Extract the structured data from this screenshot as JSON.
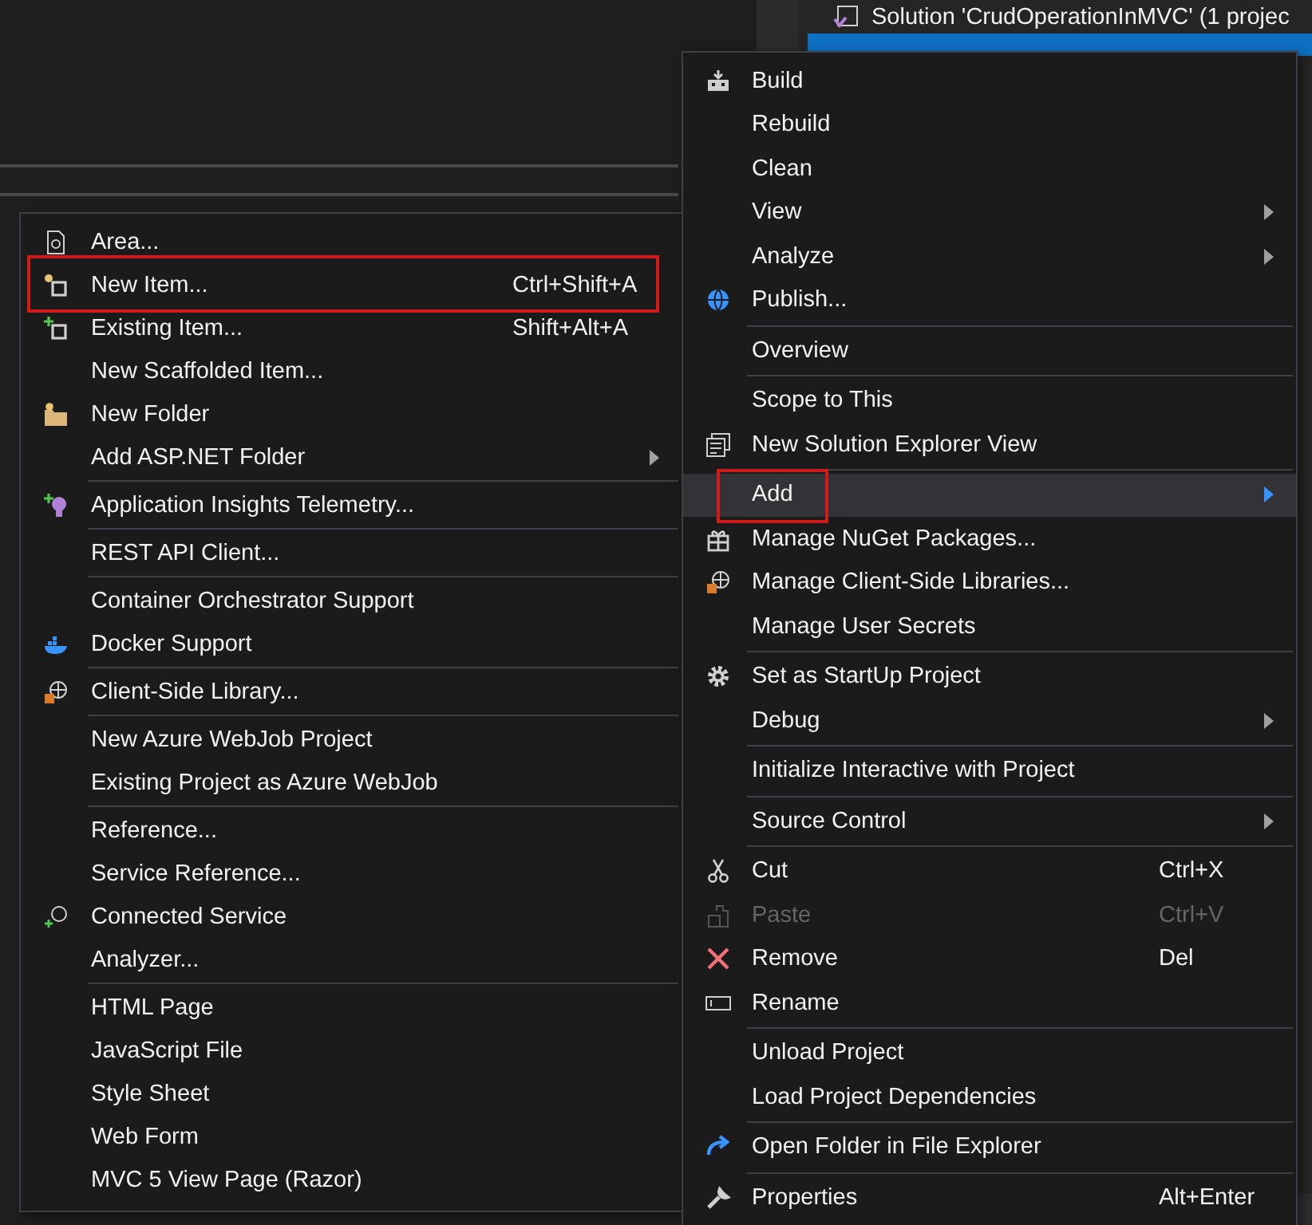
{
  "solution_explorer": {
    "solution_row": "Solution 'CrudOperationInMVC' (1 projec",
    "project_row_selected": true
  },
  "context_menu": {
    "items": [
      {
        "kind": "item",
        "label": "Build",
        "submenu": false,
        "selected": false,
        "disabled": false,
        "outlined": false
      },
      {
        "kind": "item",
        "label": "Rebuild",
        "submenu": false,
        "selected": false,
        "disabled": false,
        "outlined": false
      },
      {
        "kind": "item",
        "label": "Clean",
        "submenu": false,
        "selected": false,
        "disabled": false,
        "outlined": false
      },
      {
        "kind": "item",
        "label": "View",
        "submenu": true,
        "selected": false,
        "disabled": false,
        "outlined": false
      },
      {
        "kind": "item",
        "label": "Analyze",
        "submenu": true,
        "selected": false,
        "disabled": false,
        "outlined": false
      },
      {
        "kind": "item",
        "label": "Publish...",
        "submenu": false,
        "selected": false,
        "disabled": false,
        "outlined": false
      },
      {
        "kind": "separator"
      },
      {
        "kind": "item",
        "label": "Overview",
        "submenu": false,
        "selected": false,
        "disabled": false,
        "outlined": false
      },
      {
        "kind": "separator"
      },
      {
        "kind": "item",
        "label": "Scope to This",
        "submenu": false,
        "selected": false,
        "disabled": false,
        "outlined": false
      },
      {
        "kind": "item",
        "label": "New Solution Explorer View",
        "submenu": false,
        "selected": false,
        "disabled": false,
        "outlined": false
      },
      {
        "kind": "separator"
      },
      {
        "kind": "item",
        "label": "Add",
        "submenu": true,
        "selected": true,
        "disabled": false,
        "outlined": true
      },
      {
        "kind": "item",
        "label": "Manage NuGet Packages...",
        "submenu": false,
        "selected": false,
        "disabled": false,
        "outlined": false
      },
      {
        "kind": "item",
        "label": "Manage Client-Side Libraries...",
        "submenu": false,
        "selected": false,
        "disabled": false,
        "outlined": false
      },
      {
        "kind": "item",
        "label": "Manage User Secrets",
        "submenu": false,
        "selected": false,
        "disabled": false,
        "outlined": false
      },
      {
        "kind": "separator"
      },
      {
        "kind": "item",
        "label": "Set as StartUp Project",
        "submenu": false,
        "selected": false,
        "disabled": false,
        "outlined": false
      },
      {
        "kind": "item",
        "label": "Debug",
        "submenu": true,
        "selected": false,
        "disabled": false,
        "outlined": false
      },
      {
        "kind": "separator"
      },
      {
        "kind": "item",
        "label": "Initialize Interactive with Project",
        "submenu": false,
        "selected": false,
        "disabled": false,
        "outlined": false
      },
      {
        "kind": "separator"
      },
      {
        "kind": "item",
        "label": "Source Control",
        "submenu": true,
        "selected": false,
        "disabled": false,
        "outlined": false
      },
      {
        "kind": "separator"
      },
      {
        "kind": "item",
        "label": "Cut",
        "shortcut": "Ctrl+X",
        "submenu": false,
        "selected": false,
        "disabled": false,
        "outlined": false
      },
      {
        "kind": "item",
        "label": "Paste",
        "shortcut": "Ctrl+V",
        "submenu": false,
        "selected": false,
        "disabled": true,
        "outlined": false
      },
      {
        "kind": "item",
        "label": "Remove",
        "shortcut": "Del",
        "submenu": false,
        "selected": false,
        "disabled": false,
        "outlined": false
      },
      {
        "kind": "item",
        "label": "Rename",
        "submenu": false,
        "selected": false,
        "disabled": false,
        "outlined": false
      },
      {
        "kind": "separator"
      },
      {
        "kind": "item",
        "label": "Unload Project",
        "submenu": false,
        "selected": false,
        "disabled": false,
        "outlined": false
      },
      {
        "kind": "item",
        "label": "Load Project Dependencies",
        "submenu": false,
        "selected": false,
        "disabled": false,
        "outlined": false
      },
      {
        "kind": "separator"
      },
      {
        "kind": "item",
        "label": "Open Folder in File Explorer",
        "submenu": false,
        "selected": false,
        "disabled": false,
        "outlined": false
      },
      {
        "kind": "separator"
      },
      {
        "kind": "item",
        "label": "Properties",
        "shortcut": "Alt+Enter",
        "submenu": false,
        "selected": false,
        "disabled": false,
        "outlined": false
      }
    ]
  },
  "add_submenu": {
    "items": [
      {
        "kind": "item",
        "label": "Area...",
        "submenu": false,
        "selected": false,
        "disabled": false,
        "outlined": false
      },
      {
        "kind": "item",
        "label": "New Item...",
        "shortcut": "Ctrl+Shift+A",
        "submenu": false,
        "selected": false,
        "disabled": false,
        "outlined": true
      },
      {
        "kind": "item",
        "label": "Existing Item...",
        "shortcut": "Shift+Alt+A",
        "submenu": false,
        "selected": false,
        "disabled": false,
        "outlined": false
      },
      {
        "kind": "item",
        "label": "New Scaffolded Item...",
        "submenu": false,
        "selected": false,
        "disabled": false,
        "outlined": false
      },
      {
        "kind": "item",
        "label": "New Folder",
        "submenu": false,
        "selected": false,
        "disabled": false,
        "outlined": false
      },
      {
        "kind": "item",
        "label": "Add ASP.NET Folder",
        "submenu": true,
        "selected": false,
        "disabled": false,
        "outlined": false
      },
      {
        "kind": "separator"
      },
      {
        "kind": "item",
        "label": "Application Insights Telemetry...",
        "submenu": false,
        "selected": false,
        "disabled": false,
        "outlined": false
      },
      {
        "kind": "separator"
      },
      {
        "kind": "item",
        "label": "REST API Client...",
        "submenu": false,
        "selected": false,
        "disabled": false,
        "outlined": false
      },
      {
        "kind": "separator"
      },
      {
        "kind": "item",
        "label": "Container Orchestrator Support",
        "submenu": false,
        "selected": false,
        "disabled": false,
        "outlined": false
      },
      {
        "kind": "item",
        "label": "Docker Support",
        "submenu": false,
        "selected": false,
        "disabled": false,
        "outlined": false
      },
      {
        "kind": "separator"
      },
      {
        "kind": "item",
        "label": "Client-Side Library...",
        "submenu": false,
        "selected": false,
        "disabled": false,
        "outlined": false
      },
      {
        "kind": "separator"
      },
      {
        "kind": "item",
        "label": "New Azure WebJob Project",
        "submenu": false,
        "selected": false,
        "disabled": false,
        "outlined": false
      },
      {
        "kind": "item",
        "label": "Existing Project as Azure WebJob",
        "submenu": false,
        "selected": false,
        "disabled": false,
        "outlined": false
      },
      {
        "kind": "separator"
      },
      {
        "kind": "item",
        "label": "Reference...",
        "submenu": false,
        "selected": false,
        "disabled": false,
        "outlined": false
      },
      {
        "kind": "item",
        "label": "Service Reference...",
        "submenu": false,
        "selected": false,
        "disabled": false,
        "outlined": false
      },
      {
        "kind": "item",
        "label": "Connected Service",
        "submenu": false,
        "selected": false,
        "disabled": false,
        "outlined": false
      },
      {
        "kind": "item",
        "label": "Analyzer...",
        "submenu": false,
        "selected": false,
        "disabled": false,
        "outlined": false
      },
      {
        "kind": "separator"
      },
      {
        "kind": "item",
        "label": "HTML Page",
        "submenu": false,
        "selected": false,
        "disabled": false,
        "outlined": false
      },
      {
        "kind": "item",
        "label": "JavaScript File",
        "submenu": false,
        "selected": false,
        "disabled": false,
        "outlined": false
      },
      {
        "kind": "item",
        "label": "Style Sheet",
        "submenu": false,
        "selected": false,
        "disabled": false,
        "outlined": false
      },
      {
        "kind": "item",
        "label": "Web Form",
        "submenu": false,
        "selected": false,
        "disabled": false,
        "outlined": false
      },
      {
        "kind": "item",
        "label": "MVC 5 View Page (Razor)",
        "submenu": false,
        "selected": false,
        "disabled": false,
        "outlined": false
      }
    ]
  }
}
